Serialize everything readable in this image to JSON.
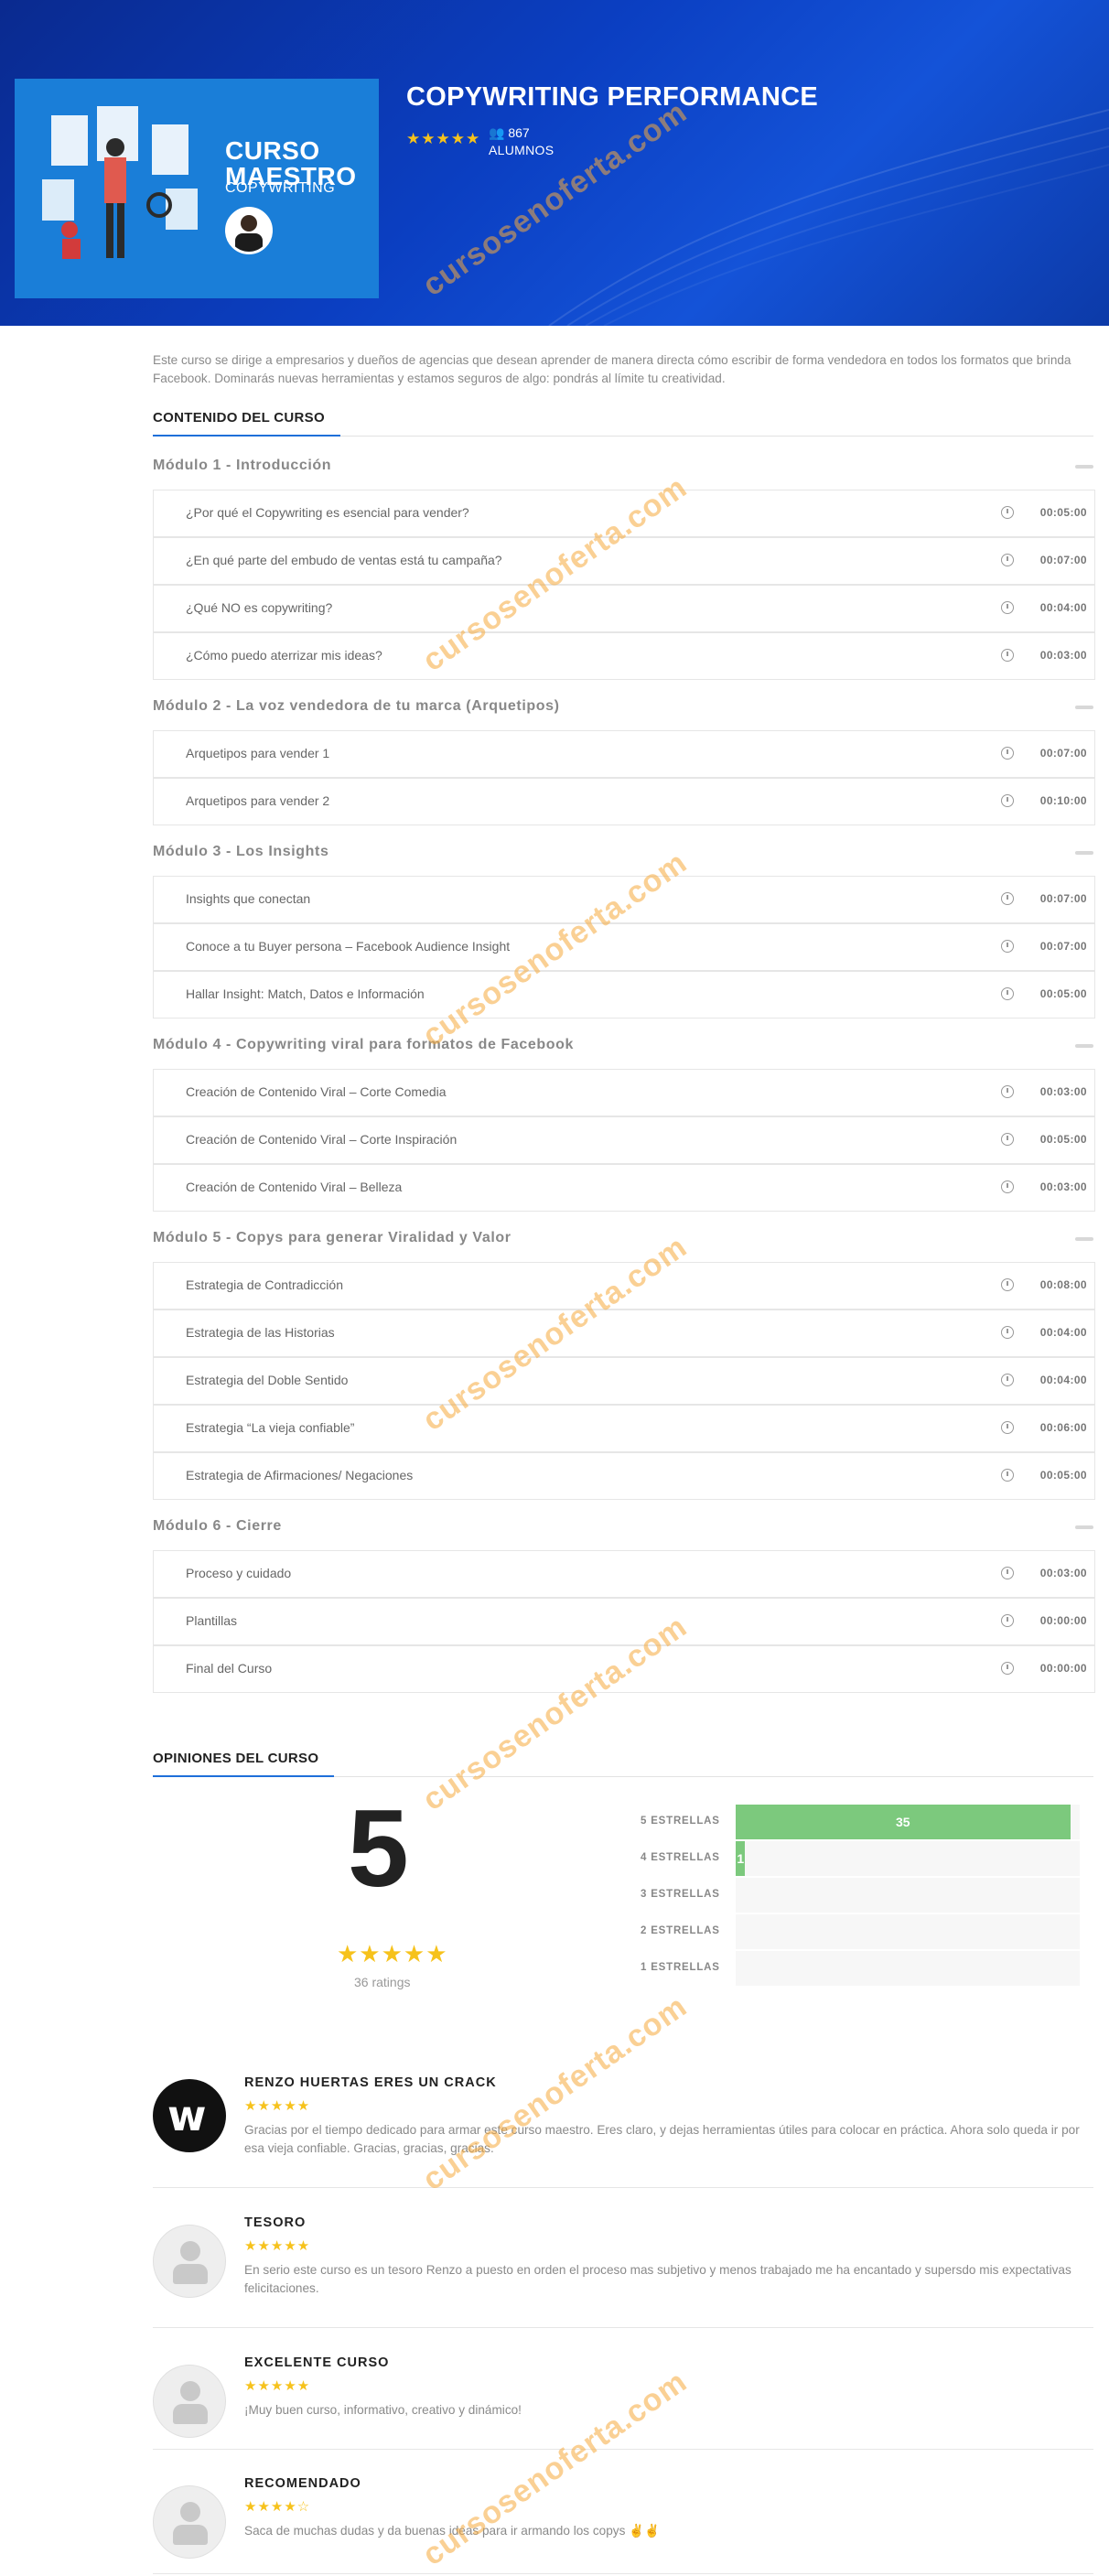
{
  "hero": {
    "thumb_line1": "CURSO",
    "thumb_line2": "MAESTRO",
    "thumb_line3": "COPYWRITING",
    "title": "COPYWRITING PERFORMANCE",
    "stars": "★★★★★",
    "students_count": "867",
    "students_label": "ALUMNOS"
  },
  "description": "Este curso se dirige a empresarios y dueños de agencias que desean aprender de manera directa cómo escribir de forma vendedora en todos los formatos que brinda Facebook. Dominarás nuevas herramientas y estamos seguros de algo: pondrás al límite tu creatividad.",
  "content_heading": "CONTENIDO DEL CURSO",
  "modules": [
    {
      "title": "Módulo 1 - Introducción",
      "lessons": [
        {
          "name": "¿Por qué el Copywriting es esencial para vender?",
          "duration": "00:05:00"
        },
        {
          "name": "¿En qué parte del embudo de ventas está tu campaña?",
          "duration": "00:07:00"
        },
        {
          "name": "¿Qué NO es copywriting?",
          "duration": "00:04:00"
        },
        {
          "name": "¿Cómo puedo aterrizar mis ideas?",
          "duration": "00:03:00"
        }
      ]
    },
    {
      "title": "Módulo 2 - La voz vendedora de tu marca (Arquetipos)",
      "lessons": [
        {
          "name": "Arquetipos para vender 1",
          "duration": "00:07:00"
        },
        {
          "name": "Arquetipos para vender 2",
          "duration": "00:10:00"
        }
      ]
    },
    {
      "title": "Módulo 3 - Los Insights",
      "lessons": [
        {
          "name": "Insights que conectan",
          "duration": "00:07:00"
        },
        {
          "name": "Conoce a tu Buyer persona – Facebook Audience Insight",
          "duration": "00:07:00"
        },
        {
          "name": "Hallar Insight: Match, Datos e Información",
          "duration": "00:05:00"
        }
      ]
    },
    {
      "title": "Módulo 4 - Copywriting viral para formatos de Facebook",
      "lessons": [
        {
          "name": "Creación de Contenido Viral – Corte Comedia",
          "duration": "00:03:00"
        },
        {
          "name": "Creación de Contenido Viral – Corte Inspiración",
          "duration": "00:05:00"
        },
        {
          "name": "Creación de Contenido Viral – Belleza",
          "duration": "00:03:00"
        }
      ]
    },
    {
      "title": "Módulo 5 - Copys para generar Viralidad y Valor",
      "lessons": [
        {
          "name": "Estrategia de Contradicción",
          "duration": "00:08:00"
        },
        {
          "name": "Estrategia de las Historias",
          "duration": "00:04:00"
        },
        {
          "name": "Estrategia del Doble Sentido",
          "duration": "00:04:00"
        },
        {
          "name": "Estrategia “La vieja confiable”",
          "duration": "00:06:00"
        },
        {
          "name": "Estrategia de Afirmaciones/ Negaciones",
          "duration": "00:05:00"
        }
      ]
    },
    {
      "title": "Módulo 6 - Cierre",
      "lessons": [
        {
          "name": "Proceso y cuidado",
          "duration": "00:03:00"
        },
        {
          "name": "Plantillas",
          "duration": "00:00:00"
        },
        {
          "name": "Final del Curso",
          "duration": "00:00:00"
        }
      ]
    }
  ],
  "reviews_heading": "OPINIONES DEL CURSO",
  "rating": {
    "average": "5",
    "stars": "★★★★★",
    "count_label": "36 ratings",
    "breakdown": [
      {
        "label": "5 ESTRELLAS",
        "count": 35,
        "shown": "35"
      },
      {
        "label": "4 ESTRELLAS",
        "count": 1,
        "shown": "1"
      },
      {
        "label": "3 ESTRELLAS",
        "count": 0,
        "shown": ""
      },
      {
        "label": "2 ESTRELLAS",
        "count": 0,
        "shown": ""
      },
      {
        "label": "1 ESTRELLAS",
        "count": 0,
        "shown": ""
      }
    ],
    "total": 36
  },
  "reviews": [
    {
      "title": "RENZO HUERTAS ERES UN CRACK",
      "stars": "★★★★★",
      "avatar": "w-logo",
      "text": "Gracias por el tiempo dedicado para armar este curso maestro. Eres claro, y dejas herramientas útiles para colocar en práctica. Ahora solo queda ir por esa vieja confiable. Gracias, gracias, gracias."
    },
    {
      "title": "TESORO",
      "stars": "★★★★★",
      "avatar": "default",
      "text": "En serio este curso es un tesoro Renzo a puesto en orden el proceso mas subjetivo y menos trabajado me ha encantado y supersdo mis expectativas felicitaciones."
    },
    {
      "title": "EXCELENTE CURSO",
      "stars": "★★★★★",
      "avatar": "default",
      "text": "¡Muy buen curso, informativo, creativo y dinámico!"
    },
    {
      "title": "RECOMENDADO",
      "stars": "★★★★☆",
      "avatar": "default",
      "text": "Saca de muchas dudas y da buenas ideas para ir armando los copys ✌✌"
    }
  ],
  "watermark": "cursosenoferta.com",
  "colors": {
    "accent": "#1e6fd9",
    "star": "#f6c21c",
    "bar": "#7cc97d",
    "hero": "#0b3fc2"
  }
}
